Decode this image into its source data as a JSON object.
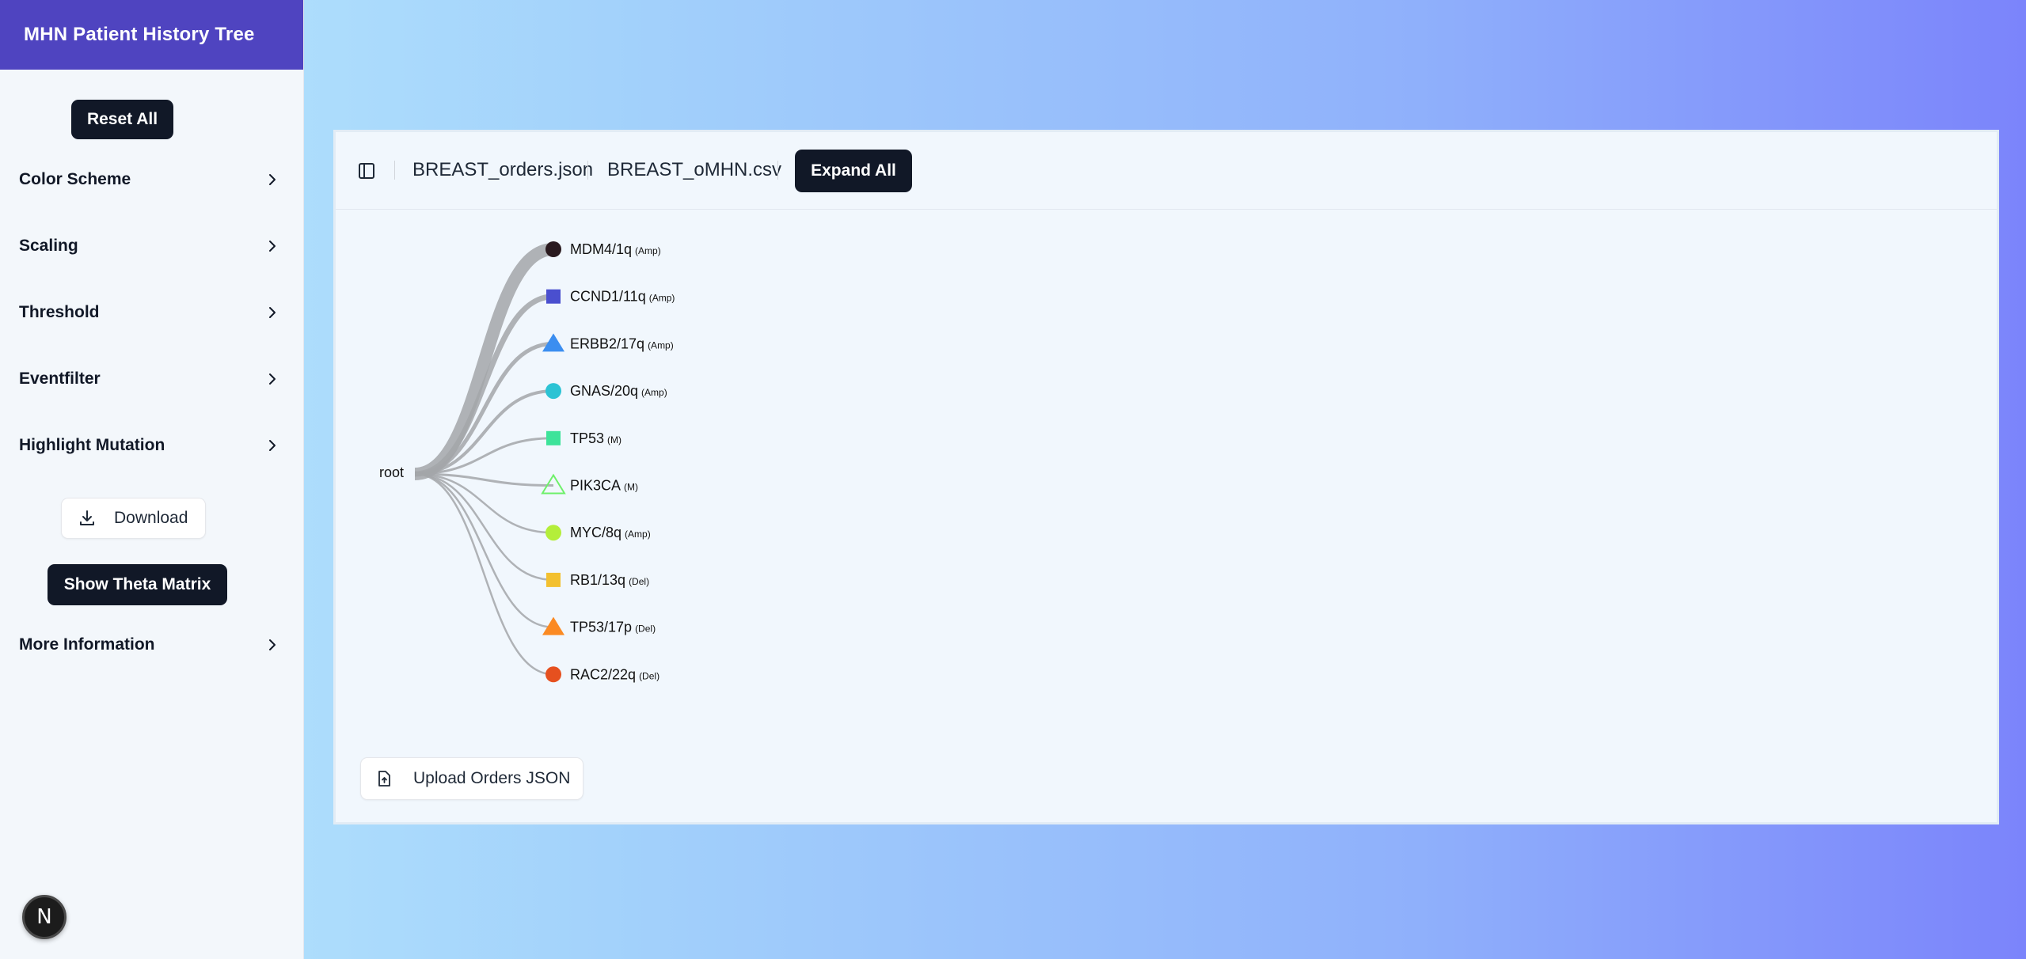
{
  "sidebar": {
    "title": "MHN Patient History Tree",
    "reset_label": "Reset All",
    "menu": [
      "Color Scheme",
      "Scaling",
      "Threshold",
      "Eventfilter",
      "Highlight Mutation"
    ],
    "download_label": "Download",
    "theta_label": "Show Theta Matrix",
    "more_info_label": "More Information",
    "badge_letter": "N"
  },
  "toolbar": {
    "file1": "BREAST_orders.json",
    "file2": "BREAST_oMHN.csv",
    "expand_label": "Expand All"
  },
  "tree": {
    "root_label": "root",
    "nodes": [
      {
        "name": "MDM4/1q",
        "type": "(Amp)",
        "shape": "circle",
        "color": "#2a1a1f",
        "filled": true
      },
      {
        "name": "CCND1/11q",
        "type": "(Amp)",
        "shape": "square",
        "color": "#4a4fcf",
        "filled": true
      },
      {
        "name": "ERBB2/17q",
        "type": "(Amp)",
        "shape": "triangle",
        "color": "#3b8ef0",
        "filled": true
      },
      {
        "name": "GNAS/20q",
        "type": "(Amp)",
        "shape": "circle",
        "color": "#2cc3d4",
        "filled": true
      },
      {
        "name": "TP53",
        "type": "(M)",
        "shape": "square",
        "color": "#3de39a",
        "filled": true
      },
      {
        "name": "PIK3CA",
        "type": "(M)",
        "shape": "triangle",
        "color": "#6ef06a",
        "filled": false
      },
      {
        "name": "MYC/8q",
        "type": "(Amp)",
        "shape": "circle",
        "color": "#b4ee3a",
        "filled": true
      },
      {
        "name": "RB1/13q",
        "type": "(Del)",
        "shape": "square",
        "color": "#f3c02f",
        "filled": true
      },
      {
        "name": "TP53/17p",
        "type": "(Del)",
        "shape": "triangle",
        "color": "#fb8a23",
        "filled": true
      },
      {
        "name": "RAC2/22q",
        "type": "(Del)",
        "shape": "circle",
        "color": "#e6501f",
        "filled": true
      }
    ]
  },
  "upload_label": "Upload Orders JSON"
}
